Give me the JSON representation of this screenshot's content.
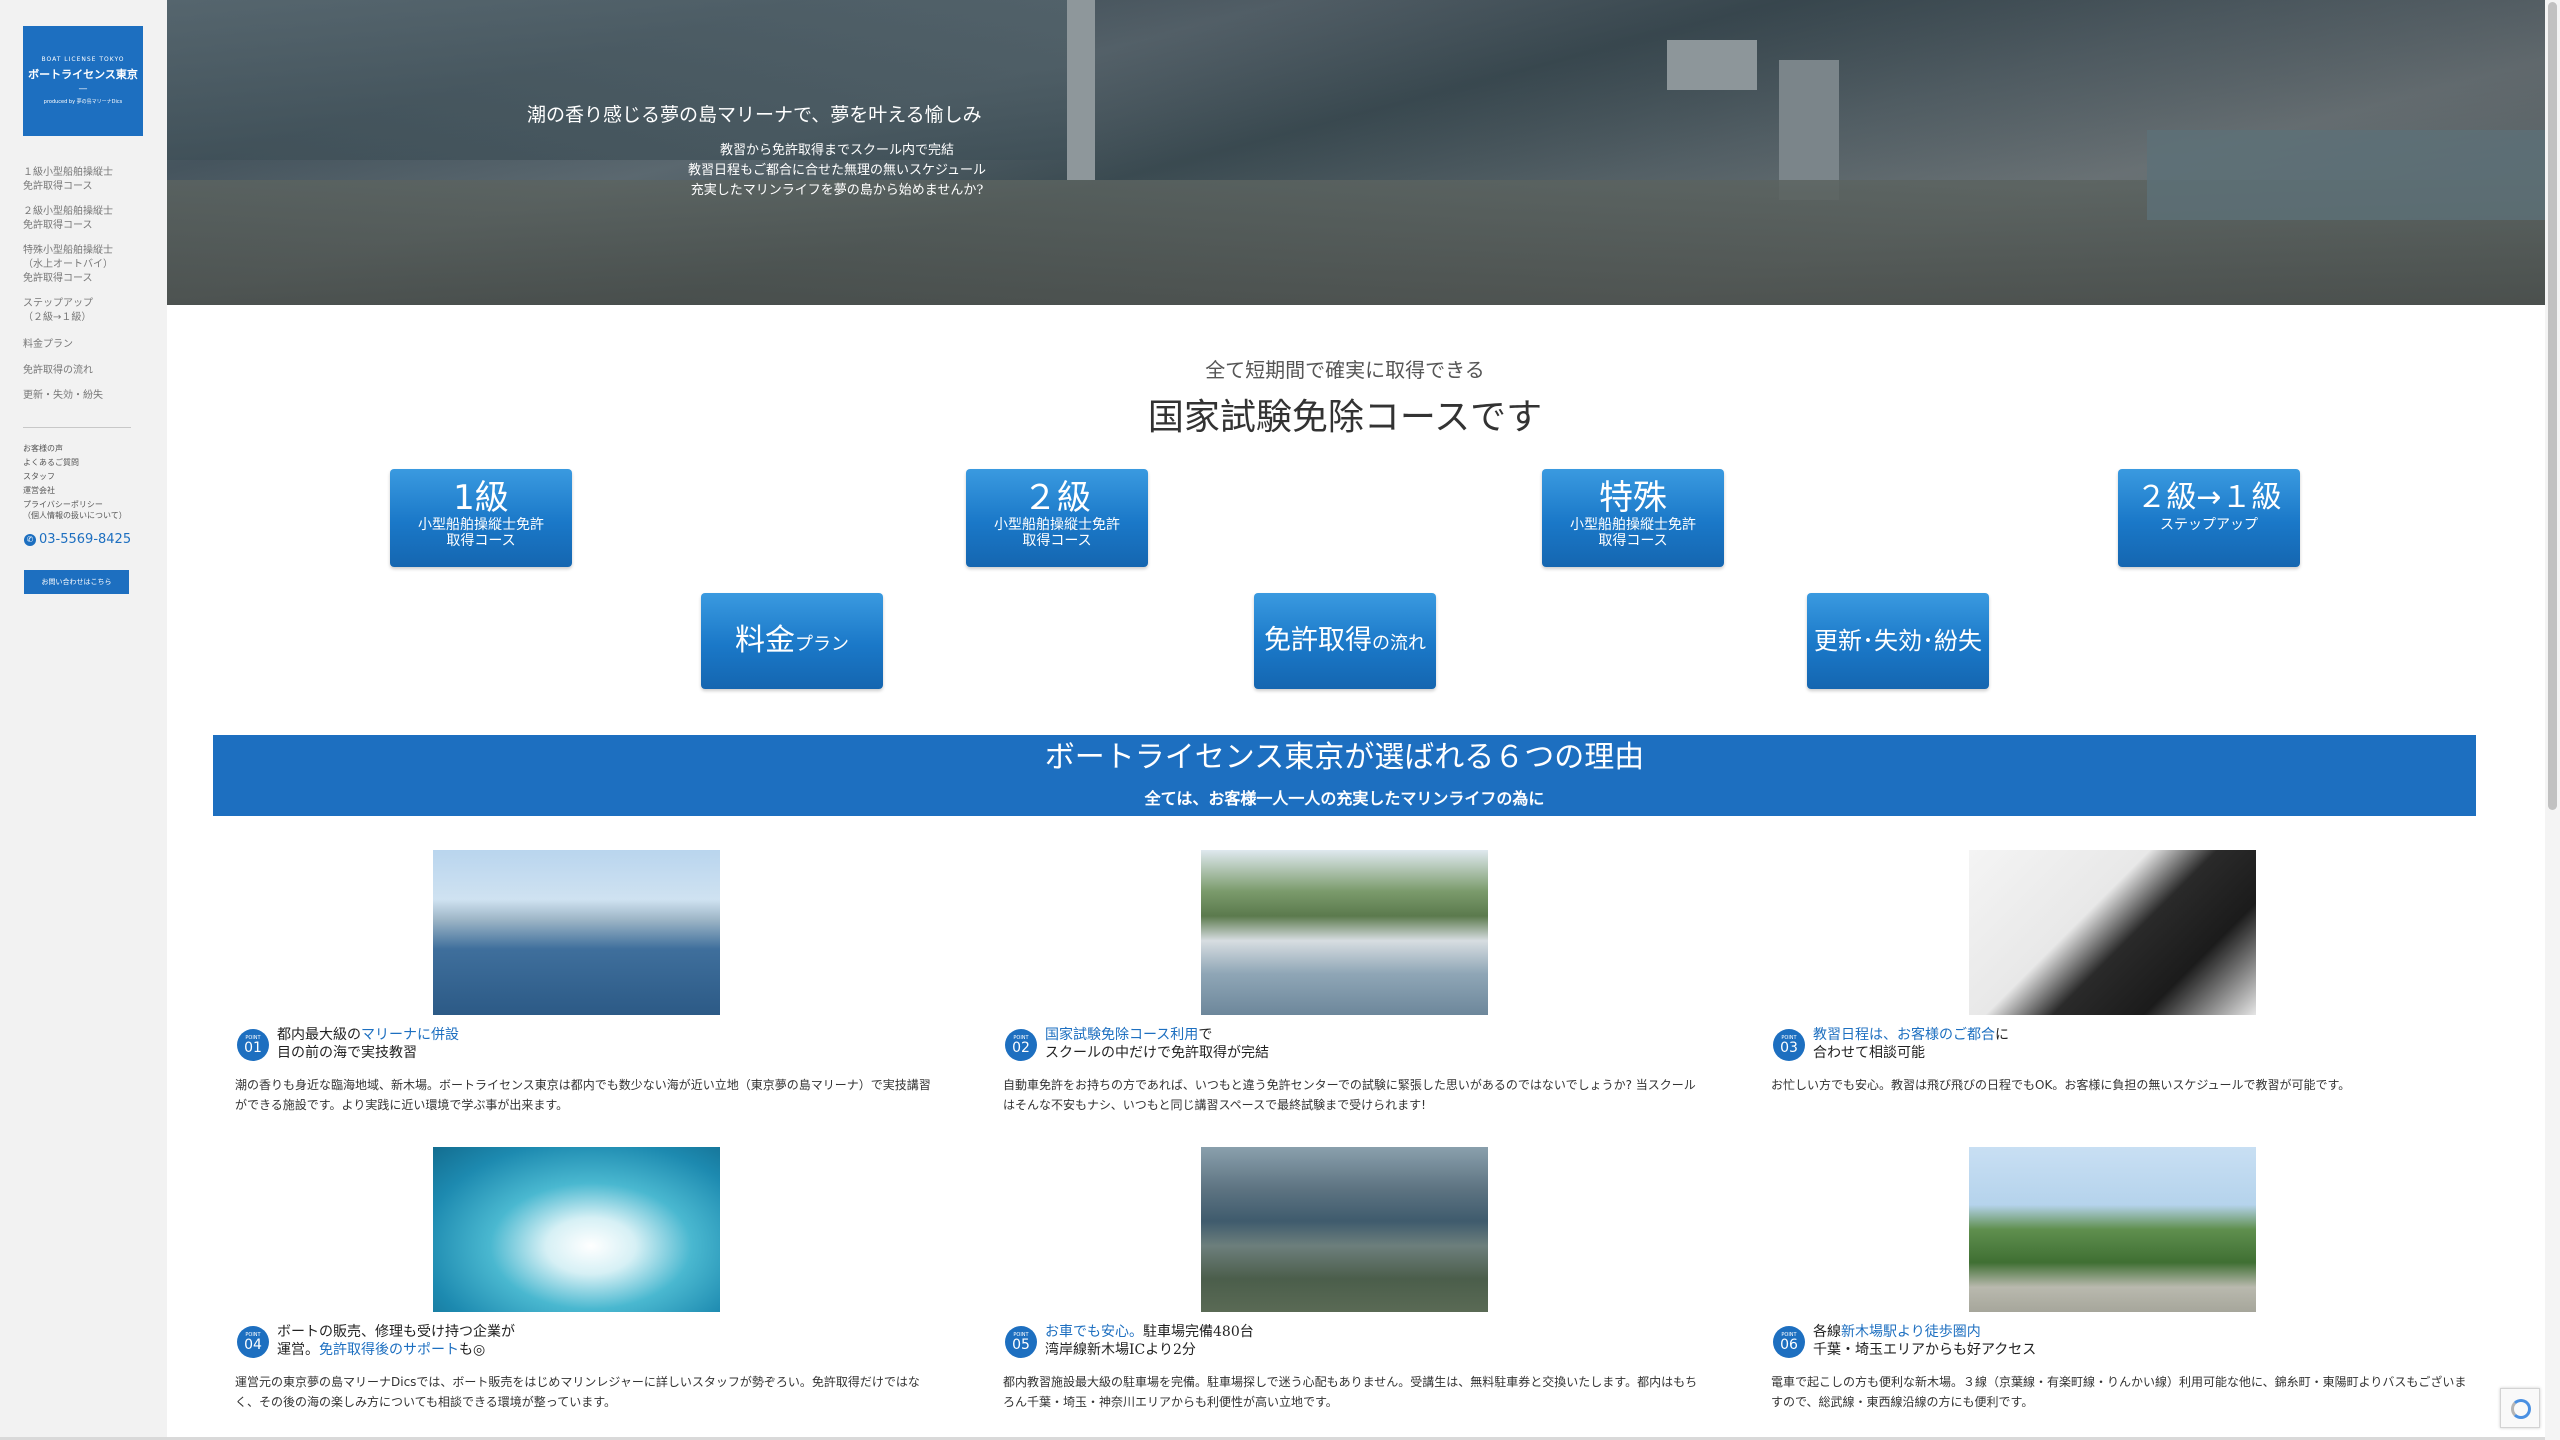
{
  "sidebar": {
    "logo": {
      "en": "BOAT LICENSE TOKYO",
      "ja": "ボートライセンス東京",
      "dash": "—",
      "sub": "produced by 夢の島マリーナDics"
    },
    "nav": [
      "１級小型船舶操縦士\n免許取得コース",
      "２級小型船舶操縦士\n免許取得コース",
      "特殊小型船舶操縦士\n（水上オートバイ）\n免許取得コース",
      "ステップアップ\n（２級→１級）",
      "料金プラン",
      "免許取得の流れ",
      "更新・失効・紛失"
    ],
    "small_links": [
      "お客様の声",
      "よくあるご質問",
      "スタッフ",
      "運営会社",
      "プライバシーポリシー\n（個人情報の扱いについて）"
    ],
    "phone": "03-5569-8425",
    "contact_button": "お問い合わせはこちら"
  },
  "hero": {
    "title": "潮の香り感じる夢の島マリーナで、夢を叶える愉しみ",
    "lines": [
      "教習から免許取得までスクール内で完結",
      "教習日程もご都合に合せた無理の無いスケジュール",
      "充実したマリンライフを夢の島から始めませんか?"
    ]
  },
  "courses": {
    "subtitle": "全て短期間で確実に取得できる",
    "title": "国家試験免除コースです",
    "row1": [
      {
        "big": "1級",
        "small": "小型船舶操縦士免許\n取得コース"
      },
      {
        "big": "２級",
        "small": "小型船舶操縦士免許\n取得コース"
      },
      {
        "big": "特殊",
        "small": "小型船舶操縦士免許\n取得コース"
      },
      {
        "big": "２級→１級",
        "small": "ステップアップ"
      }
    ],
    "row2": [
      {
        "main": "料金",
        "tail": "プラン"
      },
      {
        "main": "免許取得",
        "tail": "の流れ"
      },
      {
        "main": "更新･失効･紛失",
        "tail": ""
      }
    ]
  },
  "reasons": {
    "title": "ボートライセンス東京が選ばれる６つの理由",
    "subtitle": "全ては、お客様一人一人の充実したマリンライフの為に",
    "badge_label": "POINT",
    "items": [
      {
        "num": "01",
        "photo_icon": "marina-photo",
        "heading_pre": "都内最大級の",
        "heading_hl": "マリーナに併設",
        "heading_post": "",
        "heading_line2": "目の前の海で実技教習",
        "body": "潮の香りも身近な臨海地域、新木場。ボートライセンス東京は都内でも数少ない海が近い立地（東京夢の島マリーナ）で実技講習ができる施設です。より実践に近い環境で学ぶ事が出来ます。"
      },
      {
        "num": "02",
        "photo_icon": "boat-photo",
        "heading_pre": "",
        "heading_hl": "国家試験免除コース利用",
        "heading_post": "で",
        "heading_line2": "スクールの中だけで免許取得が完結",
        "body": "自動車免許をお持ちの方であれば、いつもと違う免許センターでの試験に緊張した思いがあるのではないでしょうか? 当スクールはそんな不安もナシ、いつもと同じ講習スペースで最終試験まで受けられます!"
      },
      {
        "num": "03",
        "photo_icon": "schedule-photo",
        "heading_pre": "",
        "heading_hl": "教習日程は、お客様のご都合",
        "heading_post": "に",
        "heading_line2": "合わせて相談可能",
        "body": "お忙しい方でも安心。教習は飛び飛びの日程でもOK。お客様に負担の無いスケジュールで教習が可能です。"
      },
      {
        "num": "04",
        "photo_icon": "speedboat-photo",
        "heading_pre": "ボートの販売、修理も受け持つ企業が",
        "heading_hl": "",
        "heading_post": "",
        "heading_line2_pre": "運営。",
        "heading_line2_hl": "免許取得後のサポート",
        "heading_line2_post": "も◎",
        "body": "運営元の東京夢の島マリーナDicsでは、ボート販売をはじめマリンレジャーに詳しいスタッフが勢ぞろい。免許取得だけではなく、その後の海の楽しみ方についても相談できる環境が整っています。"
      },
      {
        "num": "05",
        "photo_icon": "aerial-photo",
        "heading_pre": "",
        "heading_hl": "お車でも安心。",
        "heading_post": "駐車場完備480台",
        "heading_line2": "湾岸線新木場ICより2分",
        "body": "都内教習施設最大級の駐車場を完備。駐車場探しで迷う心配もありません。受講生は、無料駐車券と交換いたします。都内はもちろん千葉・埼玉・神奈川エリアからも利便性が高い立地です。"
      },
      {
        "num": "06",
        "photo_icon": "station-photo",
        "heading_pre": "各線",
        "heading_hl": "新木場駅より徒歩圏内",
        "heading_post": "",
        "heading_line2": "千葉・埼玉エリアからも好アクセス",
        "body": "電車で起こしの方も便利な新木場。３線（京葉線・有楽町線・りんかい線）利用可能な他に、錦糸町・東陽町よりバスもございますので、総武線・東西線沿線の方にも便利です。"
      }
    ]
  }
}
